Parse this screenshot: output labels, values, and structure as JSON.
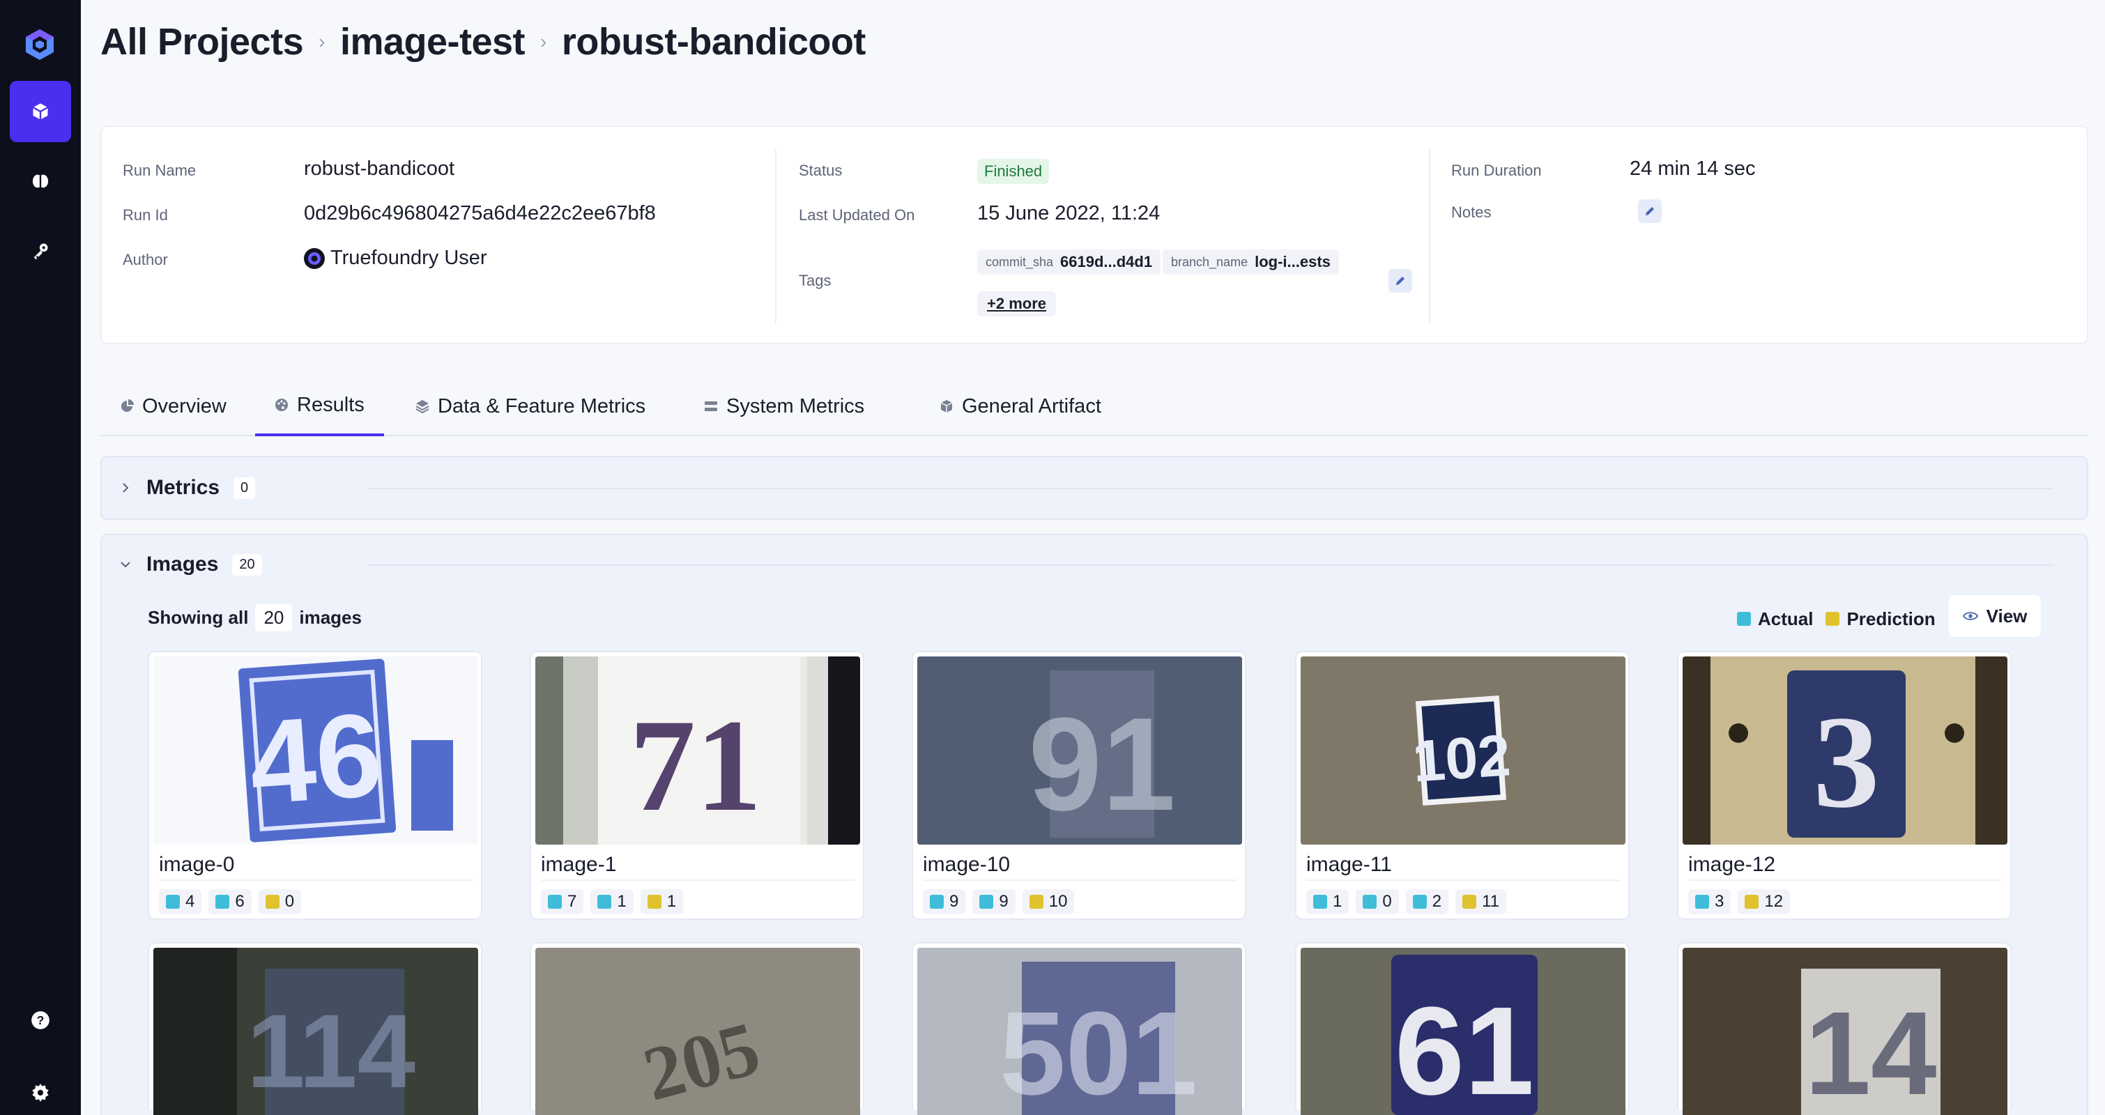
{
  "colors": {
    "accent": "#4b2ff0",
    "sidebar_bg": "#0d0f1c",
    "actual": "#3fbdd8",
    "prediction": "#dfc22e",
    "finished_bg": "#e3f6e8",
    "finished_text": "#217a3c"
  },
  "sidebar": {
    "items": [
      {
        "icon": "cube-icon",
        "active": true
      },
      {
        "icon": "brain-icon",
        "active": false
      },
      {
        "icon": "key-icon",
        "active": false
      }
    ],
    "bottom": [
      {
        "icon": "help-icon"
      },
      {
        "icon": "gear-icon"
      }
    ]
  },
  "breadcrumb": [
    "All Projects",
    "image-test",
    "robust-bandicoot"
  ],
  "run": {
    "run_name_label": "Run Name",
    "run_name": "robust-bandicoot",
    "run_id_label": "Run Id",
    "run_id": "0d29b6c496804275a6d4e22c2ee67bf8",
    "author_label": "Author",
    "author": "Truefoundry User",
    "status_label": "Status",
    "status": "Finished",
    "updated_label": "Last Updated On",
    "updated": "15 June 2022, 11:24",
    "tags_label": "Tags",
    "tags": [
      {
        "key": "commit_sha",
        "value": "6619d...d4d1"
      },
      {
        "key": "branch_name",
        "value": "log-i...ests"
      }
    ],
    "more_tags": "+2 more",
    "duration_label": "Run Duration",
    "duration": "24 min 14 sec",
    "notes_label": "Notes"
  },
  "tabs": [
    {
      "label": "Overview",
      "icon": "pie-chart-icon"
    },
    {
      "label": "Results",
      "icon": "palette-icon",
      "active": true
    },
    {
      "label": "Data & Feature Metrics",
      "icon": "layers-icon"
    },
    {
      "label": "System Metrics",
      "icon": "server-icon"
    },
    {
      "label": "General Artifact",
      "icon": "box-icon"
    }
  ],
  "metrics_section": {
    "title": "Metrics",
    "count": "0"
  },
  "images_section": {
    "title": "Images",
    "count": "20",
    "showing_prefix": "Showing all",
    "showing_count": "20",
    "showing_suffix": "images",
    "legend_actual": "Actual",
    "legend_prediction": "Prediction",
    "view_label": "View"
  },
  "images": [
    {
      "name": "image-0",
      "chips": [
        {
          "type": "actual",
          "value": "4"
        },
        {
          "type": "actual",
          "value": "6"
        },
        {
          "type": "prediction",
          "value": "0"
        }
      ]
    },
    {
      "name": "image-1",
      "chips": [
        {
          "type": "actual",
          "value": "7"
        },
        {
          "type": "actual",
          "value": "1"
        },
        {
          "type": "prediction",
          "value": "1"
        }
      ]
    },
    {
      "name": "image-10",
      "chips": [
        {
          "type": "actual",
          "value": "9"
        },
        {
          "type": "actual",
          "value": "9"
        },
        {
          "type": "prediction",
          "value": "10"
        }
      ]
    },
    {
      "name": "image-11",
      "chips": [
        {
          "type": "actual",
          "value": "1"
        },
        {
          "type": "actual",
          "value": "0"
        },
        {
          "type": "actual",
          "value": "2"
        },
        {
          "type": "prediction",
          "value": "11"
        }
      ]
    },
    {
      "name": "image-12",
      "chips": [
        {
          "type": "actual",
          "value": "3"
        },
        {
          "type": "prediction",
          "value": "12"
        }
      ]
    }
  ]
}
